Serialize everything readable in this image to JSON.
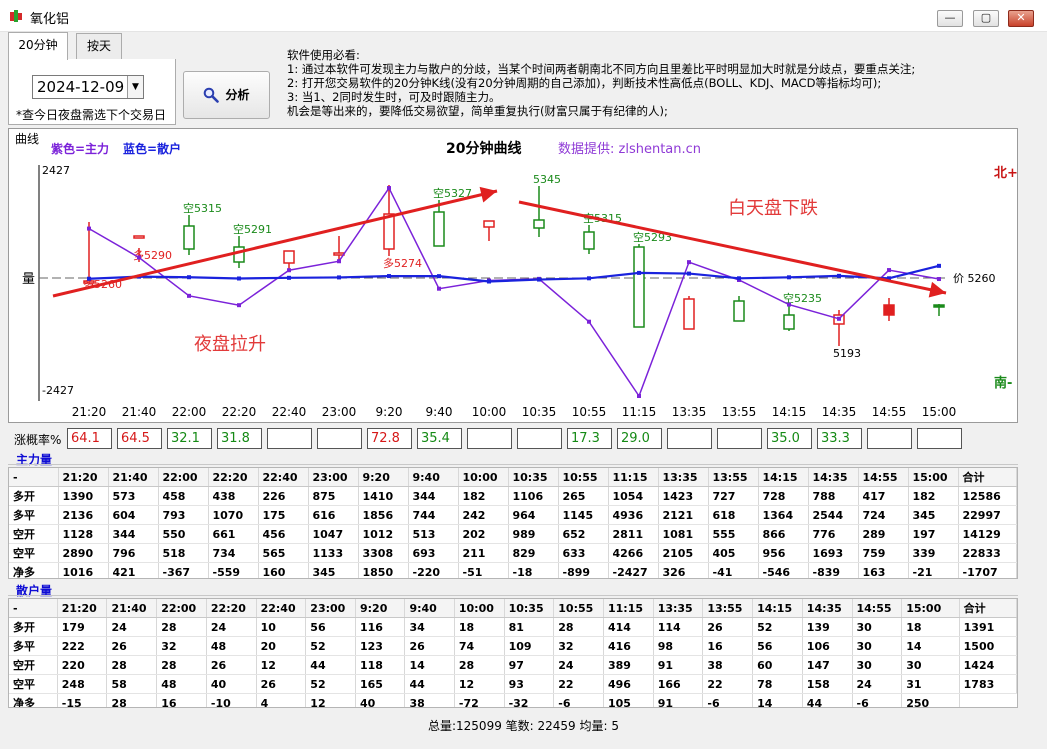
{
  "window": {
    "title": "氧化铝",
    "minimize_label": "—",
    "maximize_label": "▢",
    "close_label": "✕"
  },
  "tabs": [
    {
      "label": "20分钟"
    },
    {
      "label": "按天"
    }
  ],
  "date_select": {
    "value": "2024-12-09"
  },
  "night_note": "*查今日夜盘需选下个交易日",
  "analyze_button": {
    "label": "分析",
    "icon": "magnifier-icon"
  },
  "instructions": {
    "title": "软件使用必看:",
    "lines": [
      "1: 通过本软件可发现主力与散户的分歧，当某个时间两者朝南北不同方向且里差比平时明显加大时就是分歧点，要重点关注;",
      "2: 打开您交易软件的20分钟K线(没有20分钟周期的自己添加)，判断技术性高低点(BOLL、KDJ、MACD等指标均可);",
      "3: 当1、2同时发生时，可及时跟随主力。",
      "机会是等出来的，要降低交易欲望，简单重复执行(财富只属于有纪律的人);"
    ]
  },
  "chart": {
    "caption": "曲线",
    "legend_main": "紫色=主力",
    "legend_retail": "蓝色=散户",
    "title": "20分钟曲线",
    "source": "数据提供: zlshentan.cn",
    "north_label": "北+",
    "south_label": "南-",
    "axis_label": "量",
    "axis_top": "2427",
    "axis_bottom": "-2427",
    "price_label": "价 5260",
    "annotation_up": "夜盘拉升",
    "annotation_down": "白天盘下跌",
    "colors": {
      "main": "#7b22d9",
      "retail": "#1a22dd",
      "up": "#e02020",
      "down": "#1a8a1a",
      "arrow": "#e02020"
    }
  },
  "chart_data": {
    "type": "line",
    "categories": [
      "21:20",
      "21:40",
      "22:00",
      "22:20",
      "22:40",
      "23:00",
      "9:20",
      "9:40",
      "10:00",
      "10:35",
      "10:55",
      "11:15",
      "13:35",
      "13:55",
      "14:15",
      "14:35",
      "14:55",
      "15:00"
    ],
    "ylim": [
      -2427,
      2427
    ],
    "series": [
      {
        "name": "主力",
        "values": [
          1016,
          421,
          -367,
          -559,
          160,
          345,
          1850,
          -220,
          -51,
          -18,
          -899,
          -2427,
          326,
          -41,
          -546,
          -839,
          163,
          -21
        ]
      },
      {
        "name": "散户",
        "values": [
          -15,
          28,
          16,
          -10,
          4,
          12,
          40,
          38,
          -72,
          -32,
          -6,
          105,
          91,
          -6,
          14,
          44,
          -6,
          250
        ]
      }
    ],
    "candles": [
      {
        "dir": "up",
        "label": "多5260",
        "label_pos": "below"
      },
      {
        "dir": "up",
        "label": "多5290",
        "label_pos": "below"
      },
      {
        "dir": "down",
        "label": "空5315",
        "label_pos": "above"
      },
      {
        "dir": "down",
        "label": "空5291",
        "label_pos": "above"
      },
      {
        "dir": "up",
        "label": "",
        "label_pos": "none"
      },
      {
        "dir": "up",
        "label": "",
        "label_pos": "none"
      },
      {
        "dir": "up",
        "label": "多5274",
        "label_pos": "below"
      },
      {
        "dir": "down",
        "label": "空5327",
        "label_pos": "above"
      },
      {
        "dir": "up",
        "label": "",
        "label_pos": "none"
      },
      {
        "dir": "down",
        "label": "5345",
        "label_pos": "above"
      },
      {
        "dir": "down",
        "label": "空5315",
        "label_pos": "above"
      },
      {
        "dir": "down",
        "label": "空5293",
        "label_pos": "above"
      },
      {
        "dir": "up",
        "label": "",
        "label_pos": "none"
      },
      {
        "dir": "down",
        "label": "",
        "label_pos": "none"
      },
      {
        "dir": "down",
        "label": "空5235",
        "label_pos": "above"
      },
      {
        "dir": "up",
        "label": "5193",
        "label_pos": "below"
      },
      {
        "dir": "up",
        "label": "",
        "label_pos": "none"
      },
      {
        "dir": "down",
        "label": "",
        "label_pos": "none"
      }
    ]
  },
  "ratio": {
    "label": "涨概率%",
    "values": [
      {
        "v": "64.1",
        "c": "red"
      },
      {
        "v": "64.5",
        "c": "red"
      },
      {
        "v": "32.1",
        "c": "green"
      },
      {
        "v": "31.8",
        "c": "green"
      },
      {
        "v": "",
        "c": ""
      },
      {
        "v": "",
        "c": ""
      },
      {
        "v": "72.8",
        "c": "red"
      },
      {
        "v": "35.4",
        "c": "green"
      },
      {
        "v": "",
        "c": ""
      },
      {
        "v": "",
        "c": ""
      },
      {
        "v": "17.3",
        "c": "green"
      },
      {
        "v": "29.0",
        "c": "green"
      },
      {
        "v": "",
        "c": ""
      },
      {
        "v": "",
        "c": ""
      },
      {
        "v": "35.0",
        "c": "green"
      },
      {
        "v": "33.3",
        "c": "green"
      },
      {
        "v": "",
        "c": ""
      },
      {
        "v": "",
        "c": ""
      }
    ]
  },
  "main_table": {
    "title": "主力量",
    "header": [
      "-",
      "21:20",
      "21:40",
      "22:00",
      "22:20",
      "22:40",
      "23:00",
      "9:20",
      "9:40",
      "10:00",
      "10:35",
      "10:55",
      "11:15",
      "13:35",
      "13:55",
      "14:15",
      "14:35",
      "14:55",
      "15:00",
      "合计"
    ],
    "rows": [
      [
        "多开",
        "1390",
        "573",
        "458",
        "438",
        "226",
        "875",
        "1410",
        "344",
        "182",
        "1106",
        "265",
        "1054",
        "1423",
        "727",
        "728",
        "788",
        "417",
        "182",
        "12586"
      ],
      [
        "多平",
        "2136",
        "604",
        "793",
        "1070",
        "175",
        "616",
        "1856",
        "744",
        "242",
        "964",
        "1145",
        "4936",
        "2121",
        "618",
        "1364",
        "2544",
        "724",
        "345",
        "22997"
      ],
      [
        "空开",
        "1128",
        "344",
        "550",
        "661",
        "456",
        "1047",
        "1012",
        "513",
        "202",
        "989",
        "652",
        "2811",
        "1081",
        "555",
        "866",
        "776",
        "289",
        "197",
        "14129"
      ],
      [
        "空平",
        "2890",
        "796",
        "518",
        "734",
        "565",
        "1133",
        "3308",
        "693",
        "211",
        "829",
        "633",
        "4266",
        "2105",
        "405",
        "956",
        "1693",
        "759",
        "339",
        "22833"
      ],
      [
        "净多",
        "1016",
        "421",
        "-367",
        "-559",
        "160",
        "345",
        "1850",
        "-220",
        "-51",
        "-18",
        "-899",
        "-2427",
        "326",
        "-41",
        "-546",
        "-839",
        "163",
        "-21",
        "-1707"
      ]
    ]
  },
  "retail_table": {
    "title": "散户量",
    "header": [
      "-",
      "21:20",
      "21:40",
      "22:00",
      "22:20",
      "22:40",
      "23:00",
      "9:20",
      "9:40",
      "10:00",
      "10:35",
      "10:55",
      "11:15",
      "13:35",
      "13:55",
      "14:15",
      "14:35",
      "14:55",
      "15:00",
      "合计"
    ],
    "rows": [
      [
        "多开",
        "179",
        "24",
        "28",
        "24",
        "10",
        "56",
        "116",
        "34",
        "18",
        "81",
        "28",
        "414",
        "114",
        "26",
        "52",
        "139",
        "30",
        "18",
        "1391"
      ],
      [
        "多平",
        "222",
        "26",
        "32",
        "48",
        "20",
        "52",
        "123",
        "26",
        "74",
        "109",
        "32",
        "416",
        "98",
        "16",
        "56",
        "106",
        "30",
        "14",
        "1500"
      ],
      [
        "空开",
        "220",
        "28",
        "28",
        "26",
        "12",
        "44",
        "118",
        "14",
        "28",
        "97",
        "24",
        "389",
        "91",
        "38",
        "60",
        "147",
        "30",
        "30",
        "1424"
      ],
      [
        "空平",
        "248",
        "58",
        "48",
        "40",
        "26",
        "52",
        "165",
        "44",
        "12",
        "93",
        "22",
        "496",
        "166",
        "22",
        "78",
        "158",
        "24",
        "31",
        "1783"
      ],
      [
        "净多",
        "-15",
        "28",
        "16",
        "-10",
        "4",
        "12",
        "40",
        "38",
        "-72",
        "-32",
        "-6",
        "105",
        "91",
        "-6",
        "14",
        "44",
        "-6",
        "250"
      ]
    ]
  },
  "status": {
    "text": "总量:125099  笔数: 22459  均量: 5"
  }
}
